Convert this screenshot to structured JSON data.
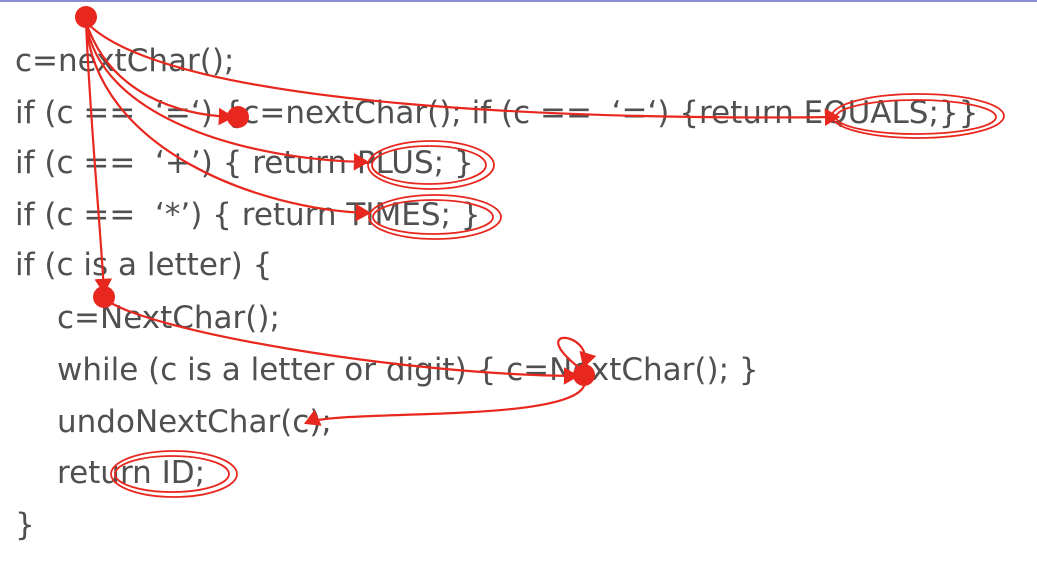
{
  "slide": {
    "code_lines": [
      "c=nextChar();",
      "if (c ==  ‘=‘) {c=nextChar(); if (c ==  ‘=‘) {return EQUALS;}}",
      "if (c ==  ‘+’) { return PLUS; }",
      "if (c ==  ‘*’) { return TIMES; }",
      "if (c is a letter) {",
      "c=NextChar();",
      "while (c is a letter or digit) { c=NextChar(); }",
      "undoNextChar(c);",
      "return ID;",
      "}"
    ]
  },
  "colors": {
    "code_text": "#505050",
    "annotation": "#e8281e",
    "top_rule": "#8c8cd4"
  }
}
